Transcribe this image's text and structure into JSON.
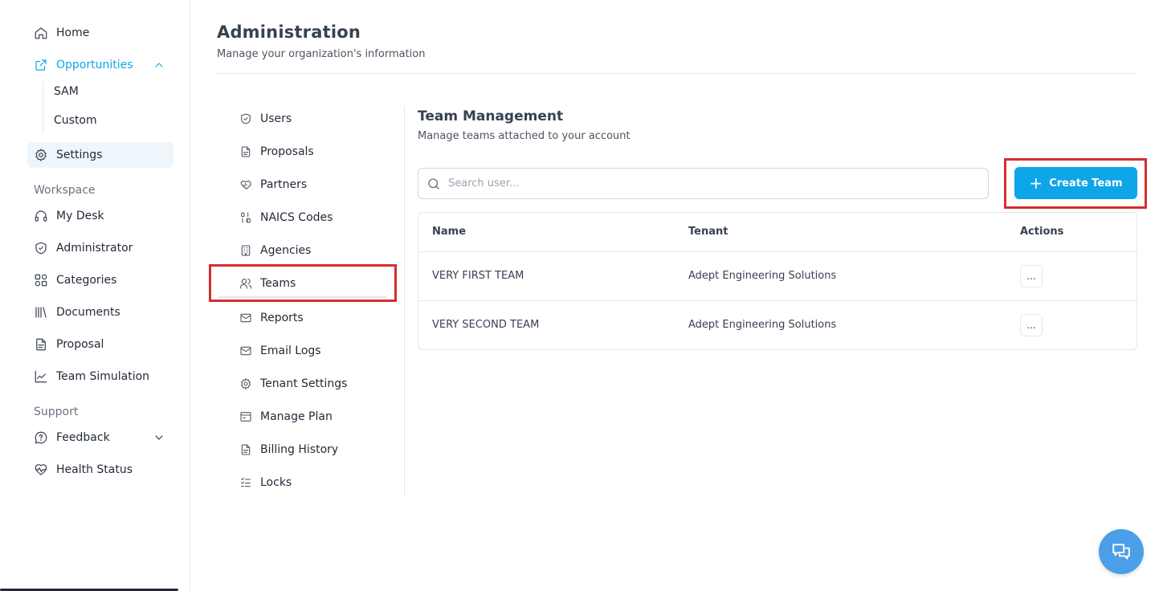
{
  "sidebar": {
    "home": "Home",
    "opportunities": "Opportunities",
    "opportunities_sub": [
      "SAM",
      "Custom"
    ],
    "settings": "Settings",
    "workspace_section": "Workspace",
    "workspace_items": [
      "My Desk",
      "Administrator",
      "Categories",
      "Documents",
      "Proposal",
      "Team Simulation"
    ],
    "support_section": "Support",
    "support_items": [
      "Feedback",
      "Health Status"
    ]
  },
  "header": {
    "title": "Administration",
    "subtitle": "Manage your organization's information"
  },
  "admin_nav": {
    "items": [
      "Users",
      "Proposals",
      "Partners",
      "NAICS Codes",
      "Agencies",
      "Teams",
      "Reports",
      "Email Logs",
      "Tenant Settings",
      "Manage Plan",
      "Billing History",
      "Locks"
    ],
    "selected": "Teams"
  },
  "team_management": {
    "title": "Team Management",
    "subtitle": "Manage teams attached to your account",
    "search_placeholder": "Search user...",
    "create_label": "Create Team",
    "table": {
      "columns": [
        "Name",
        "Tenant",
        "Actions"
      ],
      "rows": [
        {
          "name": "VERY FIRST TEAM",
          "tenant": "Adept Engineering Solutions",
          "action": "..."
        },
        {
          "name": "VERY SECOND TEAM",
          "tenant": "Adept Engineering Solutions",
          "action": "..."
        }
      ]
    }
  },
  "colors": {
    "accent": "#0ea5e9",
    "highlight_box": "#d32f2f",
    "chat_fab": "#4a9fe8"
  },
  "icons": {
    "chat": "chat-bubbles-icon"
  }
}
